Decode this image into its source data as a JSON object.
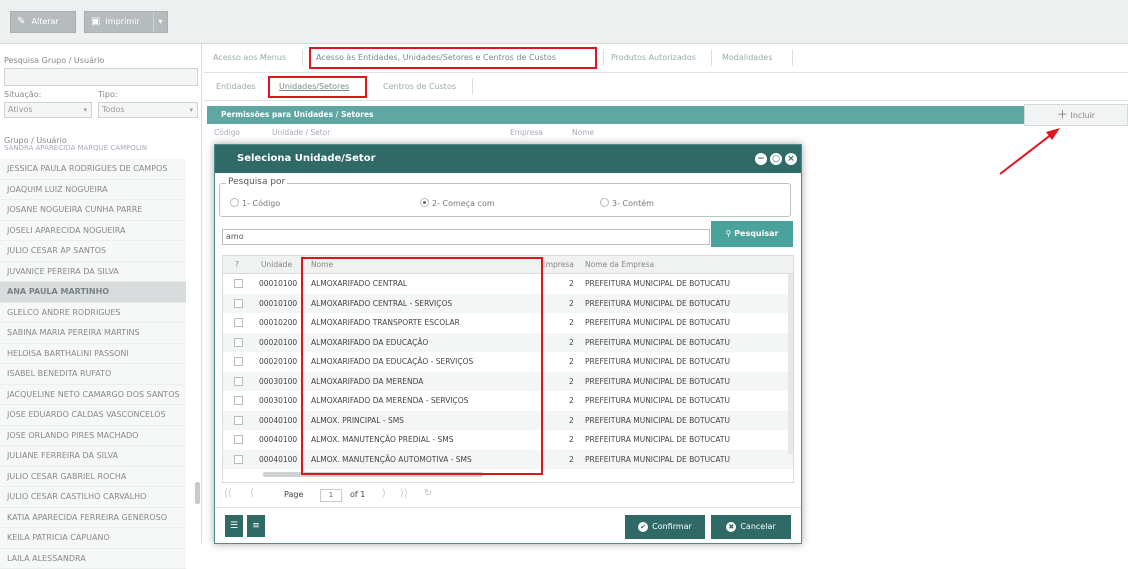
{
  "toolbar": {
    "edit_label": "Alterar",
    "print_label": "Imprimir"
  },
  "left_panel": {
    "search_label": "Pesquisa Grupo / Usuário",
    "situacao_label": "Situação:",
    "tipo_label": "Tipo:",
    "situacao_value": "Ativos",
    "tipo_value": "Todos",
    "list_header": "Grupo / Usuário",
    "list_header_overlap": "SANDRA APARECIDA MARQUE CAMPOLIN",
    "users": [
      "JESSICA PAULA RODRIGUES DE CAMPOS",
      "JOAQUIM LUIZ NOGUEIRA",
      "JOSANE NOGUEIRA CUNHA PARRE",
      "JOSELI APARECIDA NOGUEIRA",
      "JULIO CESAR AP SANTOS",
      "JUVANICE PEREIRA DA SILVA",
      "ANA PAULA MARTINHO",
      "GLELCO ANDRE RODRIGUES",
      "SABINA MARIA PEREIRA MARTINS",
      "HELOISA BARTHALINI PASSONI",
      "ISABEL BENEDITA RUFATO",
      "JACQUELINE NETO CAMARGO DOS SANTOS",
      "JOSE EDUARDO CALDAS VASCONCELOS",
      "JOSE ORLANDO PIRES MACHADO",
      "JULIANE FERREIRA DA SILVA",
      "JULIO CESAR GABRIEL ROCHA",
      "JULIO CESAR CASTILHO CARVALHO",
      "KATIA APARECIDA FERREIRA GENEROSO",
      "KEILA PATRICIA CAPUANO",
      "LAILA ALESSANDRA"
    ],
    "selected_index": 6
  },
  "tabs": [
    "Acesso aos Menus",
    "Acesso às Entidades, Unidades/Setores e Centros de Custos",
    "Produtos Autorizados",
    "Modalidades"
  ],
  "subtabs": [
    "Entidades",
    "Unidades/Setores",
    "Centros de Custos"
  ],
  "permissions": {
    "title": "Permissões para Unidades / Setores",
    "include_label": "Incluir",
    "columns": [
      "Código",
      "Unidade / Setor",
      "Empresa",
      "Nome"
    ]
  },
  "modal": {
    "title": "Seleciona Unidade/Setor",
    "search_by": "Pesquisa por",
    "options": [
      "1- Código",
      "2- Começa com",
      "3- Contém"
    ],
    "selected_option": 1,
    "query": "amo",
    "search_button": "Pesquisar",
    "columns": [
      "?",
      "Unidade",
      "Nome",
      "Empresa",
      "Nome da Empresa"
    ],
    "rows": [
      {
        "unidade": "00010100",
        "nome": "ALMOXARIFADO CENTRAL",
        "empresa": "2",
        "nome_empresa": "PREFEITURA MUNICIPAL DE BOTUCATU"
      },
      {
        "unidade": "00010100",
        "nome": "ALMOXARIFADO CENTRAL - SERVIÇOS",
        "empresa": "2",
        "nome_empresa": "PREFEITURA MUNICIPAL DE BOTUCATU"
      },
      {
        "unidade": "00010200",
        "nome": "ALMOXARIFADO TRANSPORTE ESCOLAR",
        "empresa": "2",
        "nome_empresa": "PREFEITURA MUNICIPAL DE BOTUCATU"
      },
      {
        "unidade": "00020100",
        "nome": "ALMOXARIFADO DA EDUCAÇÃO",
        "empresa": "2",
        "nome_empresa": "PREFEITURA MUNICIPAL DE BOTUCATU"
      },
      {
        "unidade": "00020100",
        "nome": "ALMOXARIFADO DA EDUCAÇÃO - SERVIÇOS",
        "empresa": "2",
        "nome_empresa": "PREFEITURA MUNICIPAL DE BOTUCATU"
      },
      {
        "unidade": "00030100",
        "nome": "ALMOXARIFADO DA MERENDA",
        "empresa": "2",
        "nome_empresa": "PREFEITURA MUNICIPAL DE BOTUCATU"
      },
      {
        "unidade": "00030100",
        "nome": "ALMOXARIFADO DA MERENDA - SERVIÇOS",
        "empresa": "2",
        "nome_empresa": "PREFEITURA MUNICIPAL DE BOTUCATU"
      },
      {
        "unidade": "00040100",
        "nome": "ALMOX. PRINCIPAL - SMS",
        "empresa": "2",
        "nome_empresa": "PREFEITURA MUNICIPAL DE BOTUCATU"
      },
      {
        "unidade": "00040100",
        "nome": "ALMOX. MANUTENÇÃO PREDIAL - SMS",
        "empresa": "2",
        "nome_empresa": "PREFEITURA MUNICIPAL DE BOTUCATU"
      },
      {
        "unidade": "00040100",
        "nome": "ALMOX. MANUTENÇÃO AUTOMOTIVA - SMS",
        "empresa": "2",
        "nome_empresa": "PREFEITURA MUNICIPAL DE BOTUCATU"
      }
    ],
    "pager": {
      "page_label": "Page",
      "page": "1",
      "of_label": "of 1"
    },
    "confirm": "Confirmar",
    "cancel": "Cancelar"
  },
  "colors": {
    "teal_dark": "#2f6a67",
    "teal": "#5fa7a3",
    "highlight_red": "#e0141e"
  }
}
